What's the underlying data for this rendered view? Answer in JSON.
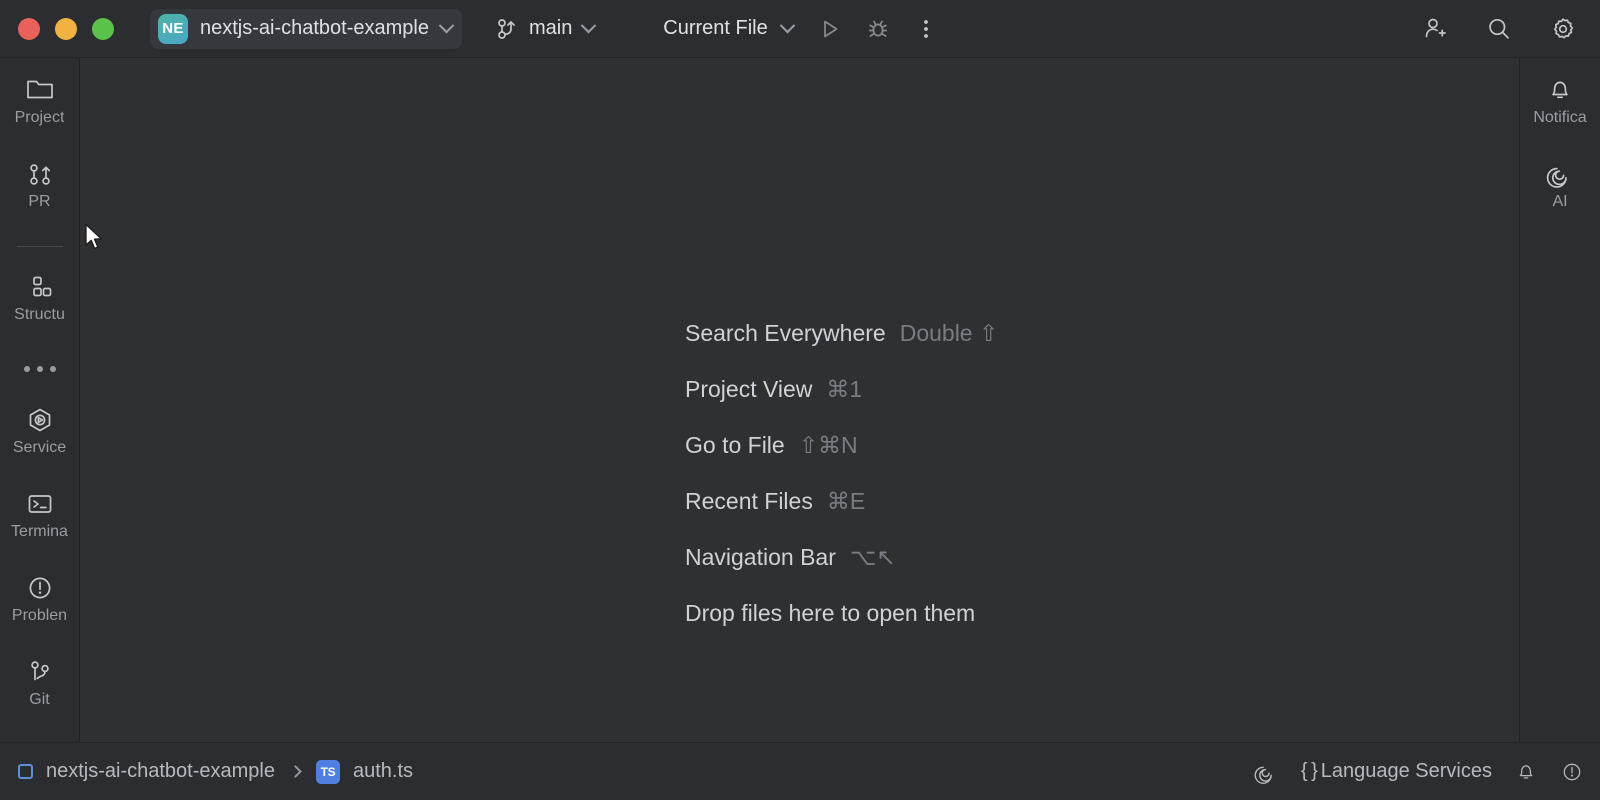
{
  "window": {
    "traffic_lights": [
      {
        "name": "close",
        "color": "#e8615a"
      },
      {
        "name": "minimize",
        "color": "#f0b341"
      },
      {
        "name": "zoom",
        "color": "#5cc14b"
      }
    ]
  },
  "titlebar": {
    "project_badge": "NE",
    "project_name": "nextjs-ai-chatbot-example",
    "branch_icon": "branch-icon",
    "branch_name": "main",
    "run_config": "Current File",
    "run_icon": "run-icon",
    "debug_icon": "debug-icon",
    "more_icon": "more-vertical-icon",
    "add_user_icon": "add-user-icon",
    "search_icon": "search-icon",
    "settings_icon": "gear-icon"
  },
  "sidebar_left": {
    "items": [
      {
        "id": "project",
        "label": "Project",
        "icon": "folder-icon"
      },
      {
        "id": "pr",
        "label": "PR",
        "icon": "pull-request-icon"
      },
      {
        "id": "structure",
        "label": "Structu",
        "icon": "structure-icon"
      },
      {
        "id": "more",
        "label": "",
        "icon": "more-horizontal-icon"
      },
      {
        "id": "services",
        "label": "Service",
        "icon": "services-icon"
      },
      {
        "id": "terminal",
        "label": "Termina",
        "icon": "terminal-icon"
      },
      {
        "id": "problems",
        "label": "Problen",
        "icon": "problems-icon"
      },
      {
        "id": "git",
        "label": "Git",
        "icon": "git-icon"
      }
    ]
  },
  "sidebar_right": {
    "items": [
      {
        "id": "notifications",
        "label": "Notifica",
        "icon": "bell-icon"
      },
      {
        "id": "ai",
        "label": "AI",
        "icon": "ai-spiral-icon"
      }
    ]
  },
  "editor": {
    "hints": [
      {
        "label": "Search Everywhere",
        "keys": "Double ⇧"
      },
      {
        "label": "Project View",
        "keys": "⌘1"
      },
      {
        "label": "Go to File",
        "keys": "⇧⌘N"
      },
      {
        "label": "Recent Files",
        "keys": "⌘E"
      },
      {
        "label": "Navigation Bar",
        "keys": "⌥↖"
      },
      {
        "label": "Drop files here to open them",
        "keys": ""
      }
    ]
  },
  "statusbar": {
    "breadcrumb": {
      "project_icon": "project-square-icon",
      "project": "nextjs-ai-chatbot-example",
      "file_badge": "TS",
      "file": "auth.ts"
    },
    "ai_icon": "ai-spiral-icon",
    "braces": "{ }",
    "language_services": "Language Services",
    "bell_icon": "bell-icon",
    "warning_icon": "exclamation-circle-icon"
  },
  "colors": {
    "titlebar_bg": "#2b2d30",
    "editor_bg": "#2e3032",
    "accent_badge": "#4fb3a5",
    "ts_badge": "#4f7fe0",
    "text_primary": "#dfe1e5",
    "text_muted": "#9a9ea3"
  }
}
